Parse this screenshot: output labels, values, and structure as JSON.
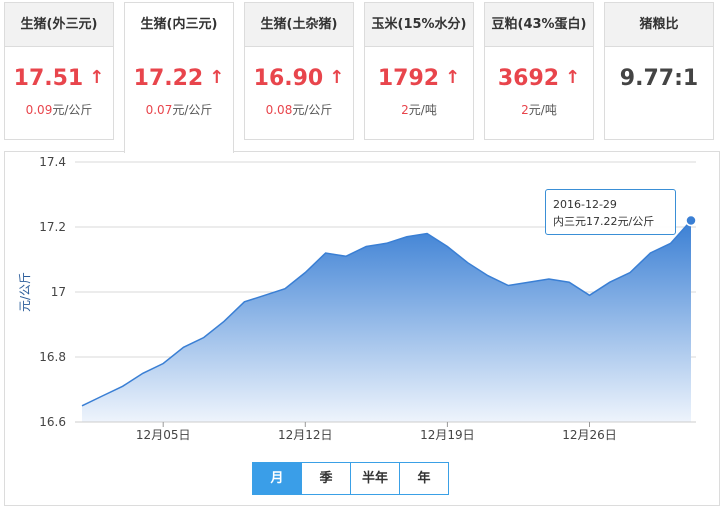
{
  "cards": [
    {
      "title": "生猪(外三元)",
      "price": "17.51",
      "change_value": "0.09",
      "change_unit": "元/公斤"
    },
    {
      "title": "生猪(内三元)",
      "price": "17.22",
      "change_value": "0.07",
      "change_unit": "元/公斤"
    },
    {
      "title": "生猪(土杂猪)",
      "price": "16.90",
      "change_value": "0.08",
      "change_unit": "元/公斤"
    },
    {
      "title": "玉米(15%水分)",
      "price": "1792",
      "change_value": "2",
      "change_unit": "元/吨"
    },
    {
      "title": "豆粕(43%蛋白)",
      "price": "3692",
      "change_value": "2",
      "change_unit": "元/吨"
    }
  ],
  "ratio_card": {
    "title": "猪粮比",
    "value": "9.77:1"
  },
  "arrow": "↑",
  "tabs": [
    "月",
    "季",
    "半年",
    "年"
  ],
  "active_tab": "月",
  "tooltip": {
    "date": "2016-12-29",
    "text": "内三元17.22元/公斤"
  },
  "colors": {
    "accent_red": "#e8454c",
    "line_blue": "#3a7fd4",
    "fill_top": "#3a7fd4",
    "fill_bottom": "#eef4fc",
    "tab_active": "#3a9ee8"
  },
  "chart_data": {
    "type": "area",
    "ylabel": "元/公斤",
    "ylim": [
      16.6,
      17.4
    ],
    "yticks": [
      "17.4",
      "17.2",
      "17",
      "16.8",
      "16.6"
    ],
    "ytick_values": [
      17.4,
      17.2,
      17.0,
      16.8,
      16.6
    ],
    "x": [
      "12-01",
      "12-02",
      "12-03",
      "12-04",
      "12-05",
      "12-06",
      "12-07",
      "12-08",
      "12-09",
      "12-10",
      "12-11",
      "12-12",
      "12-13",
      "12-14",
      "12-15",
      "12-16",
      "12-17",
      "12-18",
      "12-19",
      "12-20",
      "12-21",
      "12-22",
      "12-23",
      "12-24",
      "12-25",
      "12-26",
      "12-27",
      "12-28",
      "12-29"
    ],
    "xtick_labels": [
      {
        "index": 4,
        "label": "12月05日"
      },
      {
        "index": 11,
        "label": "12月12日"
      },
      {
        "index": 18,
        "label": "12月19日"
      },
      {
        "index": 25,
        "label": "12月26日"
      }
    ],
    "series": [
      {
        "values": [
          16.65,
          16.68,
          16.71,
          16.75,
          16.78,
          16.83,
          16.86,
          16.91,
          16.97,
          16.99,
          17.01,
          17.06,
          17.12,
          17.11,
          17.14,
          17.15,
          17.17,
          17.18,
          17.14,
          17.09,
          17.05,
          17.02,
          17.03,
          17.04,
          17.03,
          16.99,
          17.03,
          17.06,
          17.12,
          17.15,
          17.22
        ]
      }
    ],
    "grid": true
  }
}
